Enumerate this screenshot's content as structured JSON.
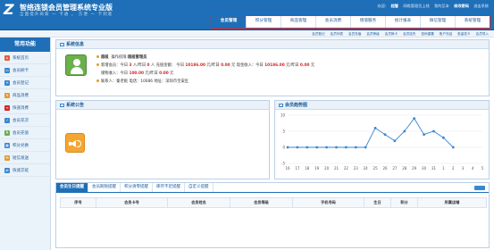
{
  "header": {
    "logo": "Z",
    "brand": "智络连锁会员管理系统专业版",
    "slogan": "全面提升商家 一 卡通 ， 方便 一 卡到底",
    "top_links": [
      "欢迎:",
      "超管",
      "网络管理员上线",
      "我的至本",
      "修改密码",
      "退出系统"
    ],
    "nav": [
      "会员管理",
      "积分管理",
      "商品管理",
      "会员消费",
      "增值服务",
      "统计报表",
      "微信管理",
      "系统管理"
    ]
  },
  "subnav": [
    "会员登记",
    "会员列表",
    "会员充值",
    "会员等级",
    "会员换卡",
    "会员挂失",
    "密码重置",
    "账户冻结",
    "批量发卡",
    "会员导入"
  ],
  "sidebar": {
    "title": "常用功能",
    "items": [
      {
        "label": "系统首页",
        "color": "#e35a3b"
      },
      {
        "label": "会员刷卡",
        "color": "#3a86cf"
      },
      {
        "label": "会员登记",
        "color": "#3a86cf"
      },
      {
        "label": "商品消费",
        "color": "#e29b2e"
      },
      {
        "label": "快速消费",
        "color": "#d3232a"
      },
      {
        "label": "会员充次",
        "color": "#3a86cf"
      },
      {
        "label": "会员充值",
        "color": "#6ab04c"
      },
      {
        "label": "积分兑换",
        "color": "#3a86cf"
      },
      {
        "label": "短信发送",
        "color": "#e29b2e"
      },
      {
        "label": "快速交班",
        "color": "#3a86cf"
      }
    ]
  },
  "info": {
    "title": "系统信息",
    "line1_prefix": "超级",
    "line1_role_label": "操作权限:",
    "line1_role": "超级管理员",
    "line2": {
      "label1": "新增会员：今日",
      "v1": "3",
      "label2": "人/昨日",
      "v2": "0",
      "label3": "人  充值金额：  今日",
      "v3": "10186.00",
      "label4": "元/昨日",
      "v4": "0.00",
      "label5": "元  现金收入：今日",
      "v5": "10186.00",
      "label6": "元/昨日",
      "v6": "0.00",
      "label7": "元"
    },
    "line3": {
      "label1": "储物收入：今日",
      "v1": "100.00",
      "label2": "元/昨日",
      "v2": "0.00",
      "label3": "元"
    },
    "line4": "联系人：秦老板  电话：10086  地址：深圳市宝安区"
  },
  "notice": {
    "title": "系统公告"
  },
  "trend": {
    "title": "会员趋势图"
  },
  "chart_data": {
    "type": "line",
    "title": "",
    "x": [
      "16",
      "17",
      "18",
      "19",
      "20",
      "21",
      "22",
      "23",
      "24",
      "25",
      "26",
      "27",
      "28",
      "29",
      "30",
      "31",
      "1",
      "2",
      "3",
      "4",
      "5"
    ],
    "series": [
      {
        "values": [
          0,
          0,
          0,
          0,
          0,
          0,
          0,
          0,
          0,
          6,
          4,
          2,
          5,
          9,
          4,
          5,
          3,
          0,
          null,
          null,
          null
        ]
      }
    ],
    "ylim": [
      -5,
      10
    ],
    "yticks": [
      -5,
      0,
      5,
      10
    ],
    "color": "#3a86cf"
  },
  "tabs": {
    "items": [
      "会员生日提醒",
      "会员期限提醒",
      "积分清零提醒",
      "库存不足提醒",
      "自定义提醒"
    ],
    "columns": [
      "序号",
      "会员卡号",
      "会员姓名",
      "会员等级",
      "手机号码",
      "生日",
      "积分",
      "所属店铺"
    ]
  }
}
